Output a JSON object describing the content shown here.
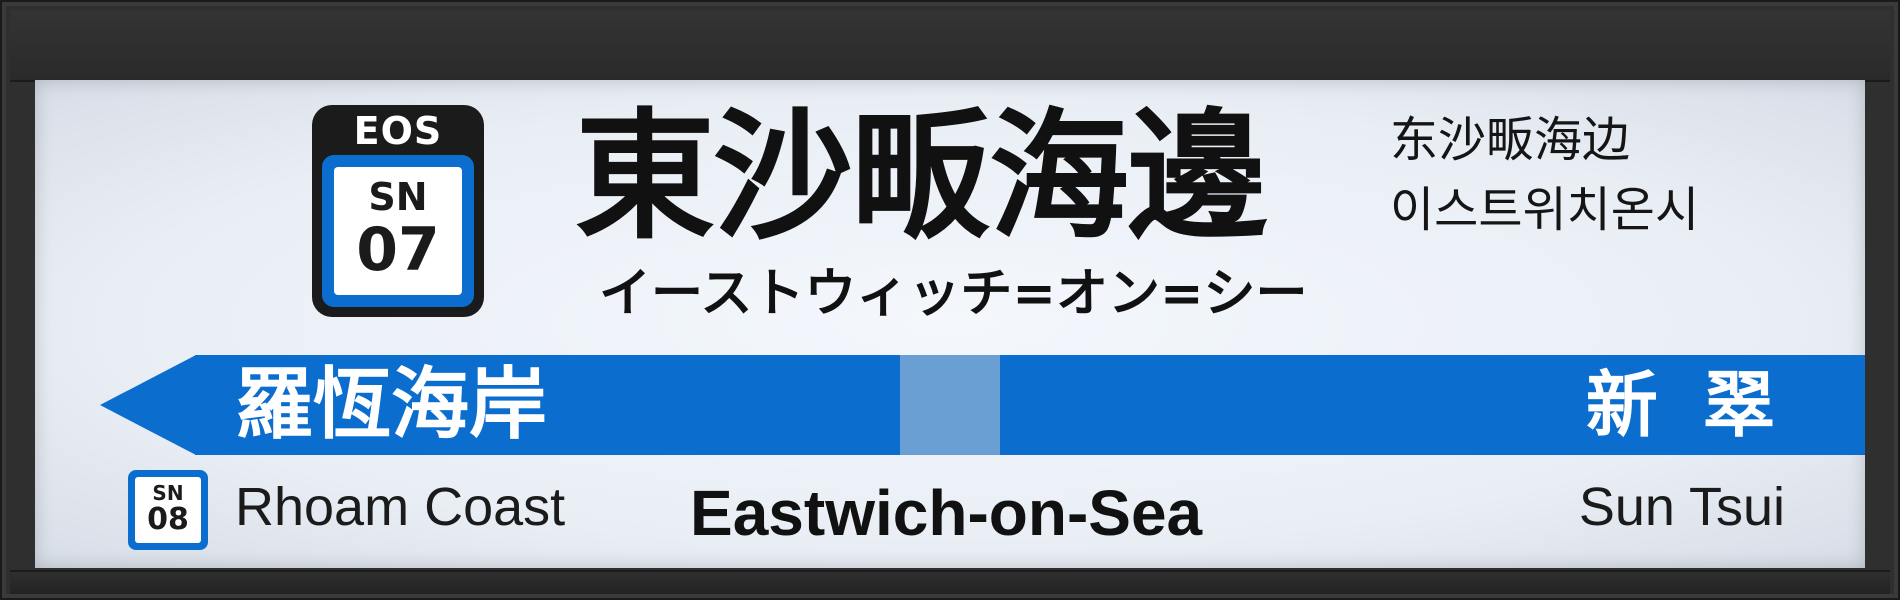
{
  "station": {
    "operator_code": "EOS",
    "line_code": "SN",
    "number": "07",
    "name_ja": "東沙畈海邊",
    "name_kana": "イーストウィッチ=オン=シー",
    "name_zh": "东沙畈海边",
    "name_ko": "이스트위치온시",
    "name_en": "Eastwich-on-Sea"
  },
  "previous_station": {
    "line_code": "SN",
    "number": "08",
    "name_ja": "羅恆海岸",
    "name_en": "Rhoam Coast"
  },
  "next_station": {
    "name_ja": "新 翠",
    "name_en": "Sun Tsui"
  },
  "colors": {
    "line_blue": "#0b6ecf",
    "band_highlight": "#6a9fd3",
    "panel_bg": "#eef3f9",
    "frame": "#2f2f2f",
    "text_dark": "#111111"
  },
  "icons": {
    "direction_arrow": "left-arrow-icon"
  }
}
